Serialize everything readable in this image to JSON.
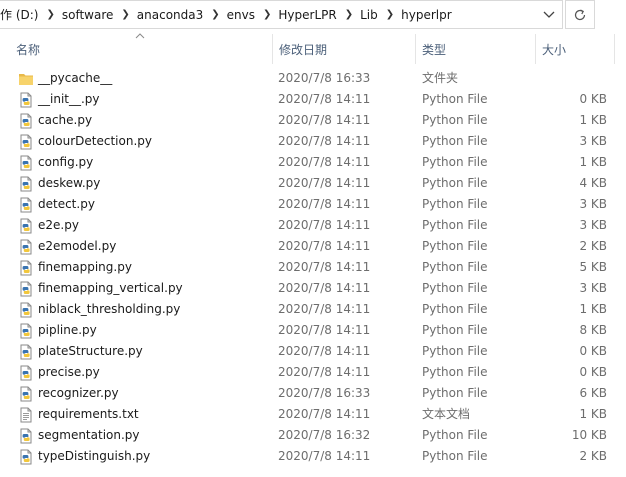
{
  "address": {
    "crumbs": [
      "作 (D:)",
      "software",
      "anaconda3",
      "envs",
      "HyperLPR",
      "Lib",
      "hyperlpr"
    ]
  },
  "columns": {
    "name": "名称",
    "date": "修改日期",
    "type": "类型",
    "size": "大小"
  },
  "files": [
    {
      "name": "__pycache__",
      "date": "2020/7/8 16:33",
      "type": "文件夹",
      "size": "",
      "icon": "folder-icon"
    },
    {
      "name": "__init__.py",
      "date": "2020/7/8 14:11",
      "type": "Python File",
      "size": "0 KB",
      "icon": "python-file-icon"
    },
    {
      "name": "cache.py",
      "date": "2020/7/8 14:11",
      "type": "Python File",
      "size": "1 KB",
      "icon": "python-file-icon"
    },
    {
      "name": "colourDetection.py",
      "date": "2020/7/8 14:11",
      "type": "Python File",
      "size": "3 KB",
      "icon": "python-file-icon"
    },
    {
      "name": "config.py",
      "date": "2020/7/8 14:11",
      "type": "Python File",
      "size": "1 KB",
      "icon": "python-file-icon"
    },
    {
      "name": "deskew.py",
      "date": "2020/7/8 14:11",
      "type": "Python File",
      "size": "4 KB",
      "icon": "python-file-icon"
    },
    {
      "name": "detect.py",
      "date": "2020/7/8 14:11",
      "type": "Python File",
      "size": "3 KB",
      "icon": "python-file-icon"
    },
    {
      "name": "e2e.py",
      "date": "2020/7/8 14:11",
      "type": "Python File",
      "size": "3 KB",
      "icon": "python-file-icon"
    },
    {
      "name": "e2emodel.py",
      "date": "2020/7/8 14:11",
      "type": "Python File",
      "size": "2 KB",
      "icon": "python-file-icon"
    },
    {
      "name": "finemapping.py",
      "date": "2020/7/8 14:11",
      "type": "Python File",
      "size": "5 KB",
      "icon": "python-file-icon"
    },
    {
      "name": "finemapping_vertical.py",
      "date": "2020/7/8 14:11",
      "type": "Python File",
      "size": "3 KB",
      "icon": "python-file-icon"
    },
    {
      "name": "niblack_thresholding.py",
      "date": "2020/7/8 14:11",
      "type": "Python File",
      "size": "1 KB",
      "icon": "python-file-icon"
    },
    {
      "name": "pipline.py",
      "date": "2020/7/8 14:11",
      "type": "Python File",
      "size": "8 KB",
      "icon": "python-file-icon"
    },
    {
      "name": "plateStructure.py",
      "date": "2020/7/8 14:11",
      "type": "Python File",
      "size": "0 KB",
      "icon": "python-file-icon"
    },
    {
      "name": "precise.py",
      "date": "2020/7/8 14:11",
      "type": "Python File",
      "size": "0 KB",
      "icon": "python-file-icon"
    },
    {
      "name": "recognizer.py",
      "date": "2020/7/8 16:33",
      "type": "Python File",
      "size": "6 KB",
      "icon": "python-file-icon"
    },
    {
      "name": "requirements.txt",
      "date": "2020/7/8 14:11",
      "type": "文本文档",
      "size": "1 KB",
      "icon": "text-file-icon"
    },
    {
      "name": "segmentation.py",
      "date": "2020/7/8 16:32",
      "type": "Python File",
      "size": "10 KB",
      "icon": "python-file-icon"
    },
    {
      "name": "typeDistinguish.py",
      "date": "2020/7/8 14:11",
      "type": "Python File",
      "size": "2 KB",
      "icon": "python-file-icon"
    }
  ]
}
